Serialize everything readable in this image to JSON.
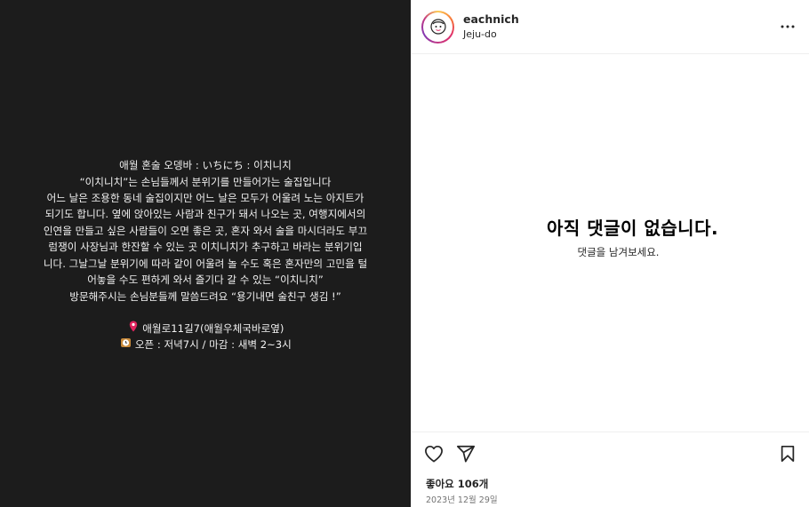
{
  "post": {
    "caption_lines": [
      "애월 혼술 오뎅바 : いちにち : 이치니치",
      "“이치니치”는 손님들께서 분위기를 만들어가는 술집입니다",
      "어느 날은 조용한 동네 술집이지만 어느 날은 모두가 어울려 노는 아지트가",
      "되기도 합니다. 옆에 앉아있는 사람과 친구가 돼서 나오는 곳, 여행지에서의",
      "인연을 만들고 싶은 사람들이 오면 좋은 곳, 혼자 와서 술을 마시더라도 부끄",
      "럼쟁이 사장님과 한잔할 수 있는 곳 이치니치가 추구하고 바라는 분위기입",
      "니다. 그날그날 분위기에 따라 같이 어울려 놀 수도 혹은 혼자만의 고민을 털",
      "어놓을 수도 편하게 와서 즐기다 갈 수 있는 “이치니치”",
      "방문해주시는 손님분들께 말씀드려요 “용기내면 술친구 생김 !”"
    ],
    "address": "애월로11길7(애월우체국바로옆)",
    "hours": "오픈 : 저녁7시 / 마감 : 새벽 2~3시",
    "address_icon": "pin-icon",
    "hours_icon": "clock-icon"
  },
  "header": {
    "username": "eachnich",
    "location": "Jeju-do",
    "more_icon": "more-icon"
  },
  "comments": {
    "empty_title": "아직 댓글이 없습니다.",
    "empty_subtitle": "댓글을 남겨보세요."
  },
  "footer": {
    "likes": "좋아요 106개",
    "date": "2023년 12월 29일",
    "icons": [
      "heart-icon",
      "share-icon",
      "bookmark-icon"
    ]
  },
  "colors": {
    "media_bg": "#1c1c1c",
    "text": "#262626",
    "muted": "#737373",
    "divider": "#efefef"
  }
}
